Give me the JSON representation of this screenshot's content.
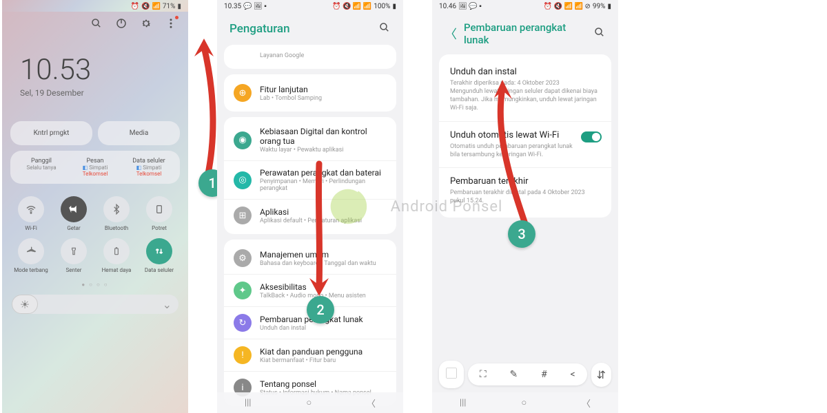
{
  "annotation": {
    "step1": "1",
    "step2": "2",
    "step3": "3"
  },
  "watermark_text": "Android Ponsel",
  "screen1": {
    "status_battery": "71%",
    "time": "10.53",
    "date": "Sel, 19 Desember",
    "card_left": "Kntrl prngkt",
    "card_right": "Media",
    "sim": {
      "call": {
        "label": "Panggil",
        "sub": "Selalu tanya"
      },
      "sms": {
        "label": "Pesan",
        "op": "Simpati",
        "prov": "Telkomsel"
      },
      "data": {
        "label": "Data seluler",
        "op": "Simpati",
        "prov": "Telkomsel"
      }
    },
    "qs": [
      {
        "label": "Wi-Fi"
      },
      {
        "label": "Getar"
      },
      {
        "label": "Bluetooth"
      },
      {
        "label": "Potret"
      },
      {
        "label": "Mode terbang"
      },
      {
        "label": "Senter"
      },
      {
        "label": "Hemat daya"
      },
      {
        "label": "Data seluler"
      }
    ]
  },
  "screen2": {
    "status_time": "10.35",
    "status_battery": "100%",
    "title": "Pengaturan",
    "partial_sub": "Layanan Google",
    "items": [
      {
        "title": "Fitur lanjutan",
        "sub": "Lab • Tombol Samping"
      },
      {
        "title": "Kebiasaan Digital dan kontrol orang tua",
        "sub": "Waktu layar • Pewaktu aplikasi"
      },
      {
        "title": "Perawatan perangkat dan baterai",
        "sub": "Penyimpanan • Memori • Perlindungan perangkat"
      },
      {
        "title": "Aplikasi",
        "sub": "Aplikasi default • Pengaturan aplikasi"
      },
      {
        "title": "Manajemen umum",
        "sub": "Bahasa dan keyboard • Tanggal dan waktu"
      },
      {
        "title": "Aksesibilitas",
        "sub": "TalkBack • Audio mono • Menu asisten"
      },
      {
        "title": "Pembaruan perangkat lunak",
        "sub": "Unduh dan instal"
      },
      {
        "title": "Kiat dan panduan pengguna",
        "sub": "Kiat bermanfaat • Fitur baru"
      },
      {
        "title": "Tentang ponsel",
        "sub": "Status • Informasi hukum • Nama ponsel"
      }
    ]
  },
  "screen3": {
    "status_time": "10.46",
    "status_battery": "99%",
    "title": "Pembaruan perangkat lunak",
    "items": [
      {
        "title": "Unduh dan instal",
        "sub": "Terakhir diperiksa pada: 4 Oktober 2023\nMengunduh lewat jaringan seluler dapat dikenai biaya tambahan. Jika memungkinkan, unduh lewat jaringan Wi-Fi saja."
      },
      {
        "title": "Unduh otomatis lewat Wi-Fi",
        "sub": "Otomatis unduh pembaruan perangkat lunak bila tersambung ke jaringan Wi-Fi."
      },
      {
        "title": "Pembaruan terakhir",
        "sub": "Pembaruan terakhir diinstal pada 4 Oktober 2023 pukul 15.24."
      }
    ]
  }
}
